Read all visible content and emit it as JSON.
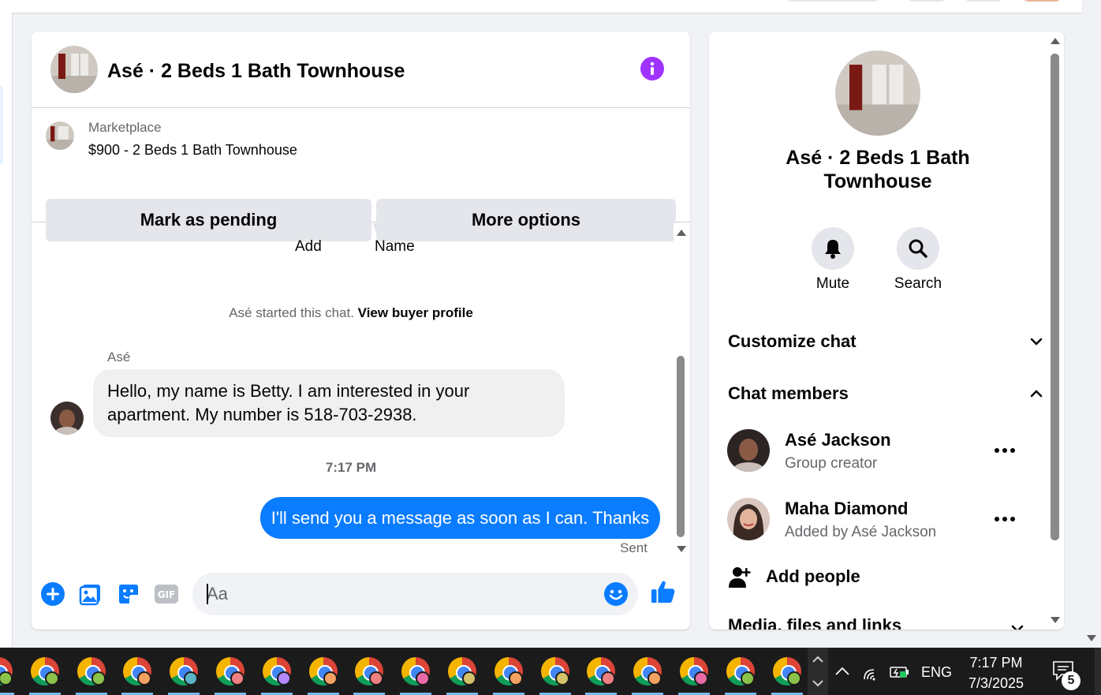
{
  "header": {
    "title": "Asé · 2 Beds 1 Bath Townhouse"
  },
  "marketplace": {
    "label": "Marketplace",
    "listing": "$900 - 2 Beds 1 Bath Townhouse",
    "mark_pending_label": "Mark as pending",
    "more_options_label": "More options"
  },
  "actions": {
    "add_label": "Add",
    "name_label": "Name"
  },
  "messages": {
    "system_prefix": "Asé started this chat.",
    "system_link": "View buyer profile",
    "sender": "Asé",
    "incoming": "Hello, my name is Betty. I am interested in your apartment. My number is 518-703-2938.",
    "timestamp": "7:17 PM",
    "outgoing": "I'll send you a message as soon as I can. Thanks",
    "status": "Sent"
  },
  "composer": {
    "placeholder": "Aa"
  },
  "sidebar": {
    "title": "Asé · 2 Beds 1 Bath Townhouse",
    "mute_label": "Mute",
    "search_label": "Search",
    "customize_label": "Customize chat",
    "members_label": "Chat members",
    "members": [
      {
        "name": "Asé Jackson",
        "role": "Group creator"
      },
      {
        "name": "Maha Diamond",
        "role": "Added by Asé Jackson"
      }
    ],
    "add_people_label": "Add people",
    "media_label": "Media, files and links"
  },
  "taskbar": {
    "language": "ENG",
    "time": "7:17 PM",
    "date": "7/3/2025",
    "notification_count": "5"
  },
  "colors": {
    "accent": "#0a7cff",
    "info": "#a033ff",
    "bubble_in": "#f0f0f0",
    "button_grey": "#e4e6eb"
  }
}
